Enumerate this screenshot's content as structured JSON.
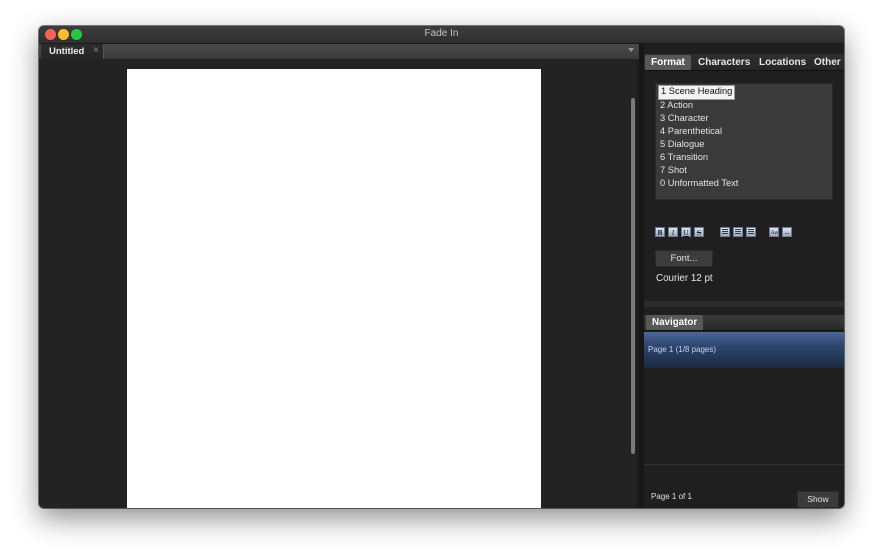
{
  "window": {
    "title": "Fade In"
  },
  "document_tab": {
    "label": "Untitled",
    "close_glyph": "×",
    "overflow_icon": "chevron-down-icon"
  },
  "right_panel": {
    "tabs": [
      "Format",
      "Characters",
      "Locations",
      "Other"
    ],
    "active_tab": "Format",
    "elements": [
      "1 Scene Heading",
      "2 Action",
      "3 Character",
      "4 Parenthetical",
      "5 Dialogue",
      "6 Transition",
      "7 Shot",
      "0 Unformatted Text"
    ],
    "selected_element": "1 Scene Heading",
    "format_buttons": {
      "bold": "B",
      "italic": "I",
      "underline": "U",
      "strikethrough": "S",
      "align_left_icon": "align-left-icon",
      "align_center_icon": "align-center-icon",
      "align_right_icon": "align-right-icon",
      "text_style_icon": "text-style-icon",
      "link_icon": "link-icon"
    },
    "font_button_label": "Font...",
    "font_info": "Courier 12 pt"
  },
  "navigator": {
    "tab_label": "Navigator",
    "page_entry": "Page 1 (1/8 pages)",
    "page_count": "Page 1 of 1",
    "show_button_label": "Show"
  },
  "colors": {
    "background": "#1e1e1e",
    "page": "#ffffff",
    "selected_nav": "#2d4570",
    "close_button": "#fc5f57",
    "minimize_button": "#fdbd2e",
    "zoom_button": "#27c840"
  }
}
